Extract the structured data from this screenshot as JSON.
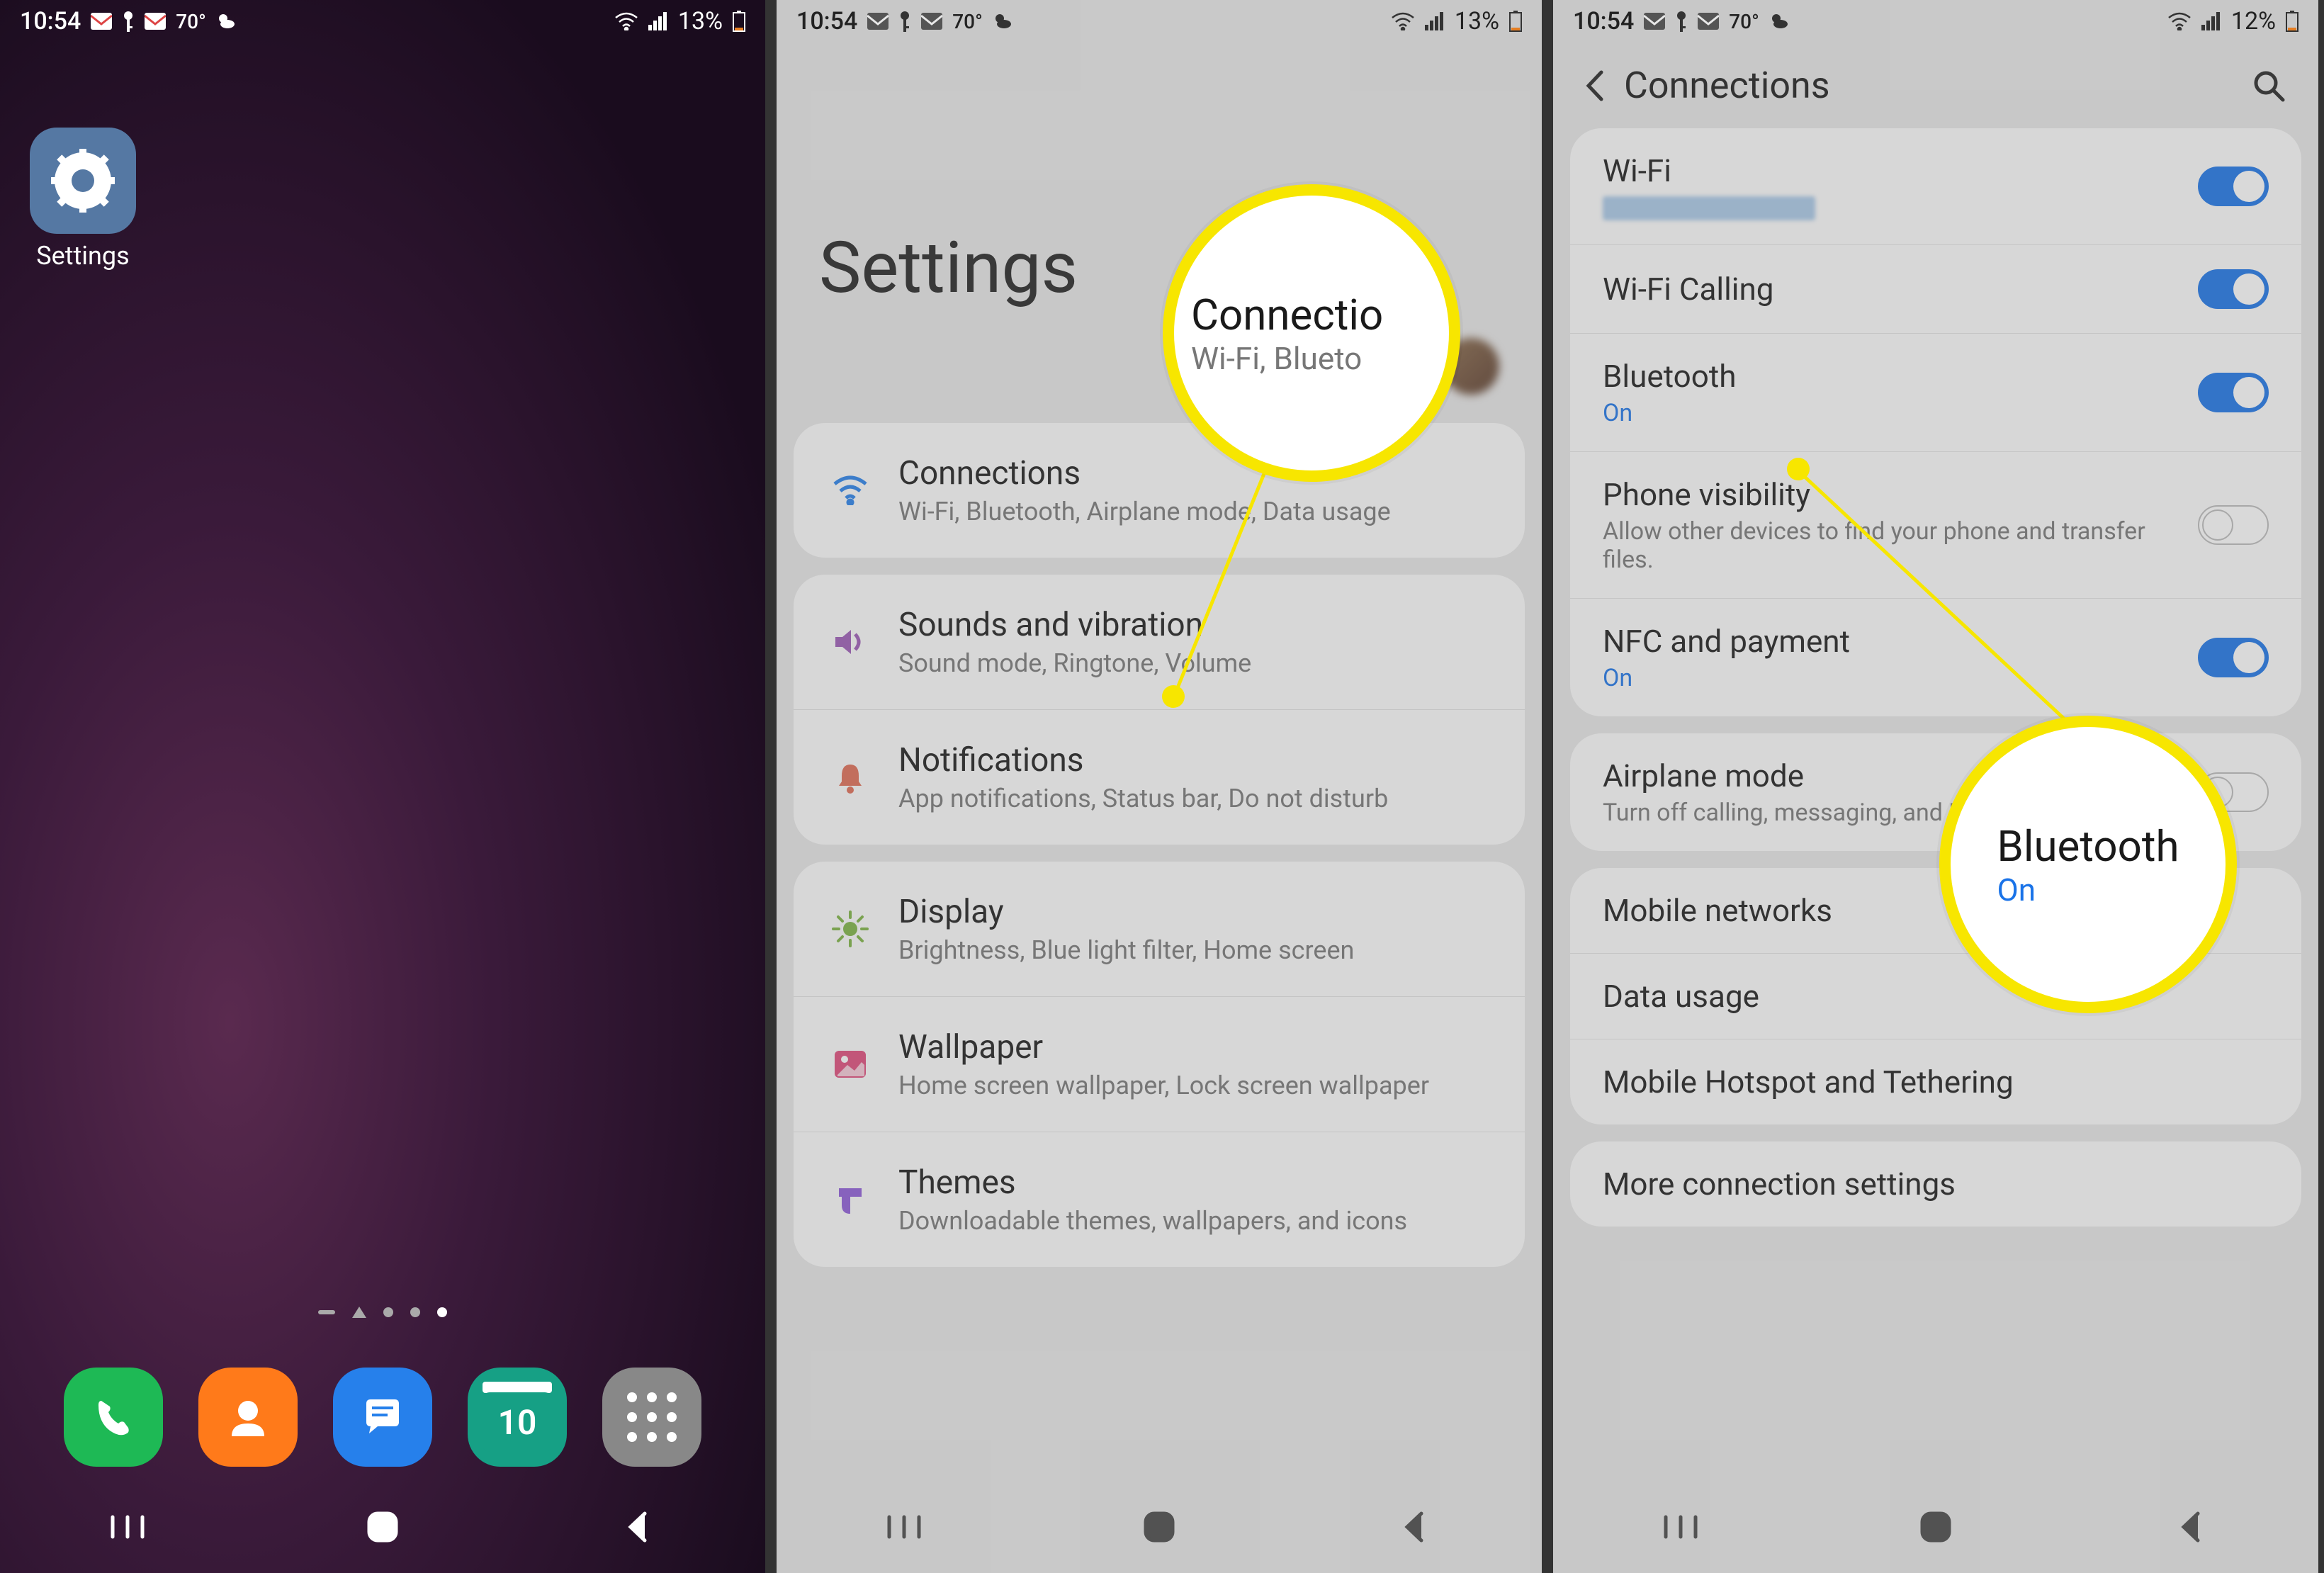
{
  "panel1": {
    "status": {
      "time": "10:54",
      "temp": "70°",
      "battery": "13%"
    },
    "settings_label": "Settings",
    "dock": {
      "calendar_day": "10"
    }
  },
  "panel2": {
    "status": {
      "time": "10:54",
      "temp": "70°",
      "battery": "13%"
    },
    "header": "Settings",
    "callout": {
      "title": "Connectio",
      "sub": "Wi-Fi, Blueto"
    },
    "groups": [
      {
        "rows": [
          {
            "icon": "wifi",
            "color": "#2680eb",
            "title": "Connections",
            "sub": "Wi-Fi, Bluetooth, Airplane mode, Data usage"
          }
        ]
      },
      {
        "rows": [
          {
            "icon": "sound",
            "color": "#9b59b6",
            "title": "Sounds and vibration",
            "sub": "Sound mode, Ringtone, Volume"
          },
          {
            "icon": "bell",
            "color": "#e06b54",
            "title": "Notifications",
            "sub": "App notifications, Status bar, Do not disturb"
          }
        ]
      },
      {
        "rows": [
          {
            "icon": "sun",
            "color": "#7cb342",
            "title": "Display",
            "sub": "Brightness, Blue light filter, Home screen"
          },
          {
            "icon": "image",
            "color": "#e04a7a",
            "title": "Wallpaper",
            "sub": "Home screen wallpaper, Lock screen wallpaper"
          },
          {
            "icon": "brush",
            "color": "#8e5ad8",
            "title": "Themes",
            "sub": "Downloadable themes, wallpapers, and icons"
          }
        ]
      }
    ]
  },
  "panel3": {
    "status": {
      "time": "10:54",
      "temp": "70°",
      "battery": "12%"
    },
    "header": "Connections",
    "callout": {
      "title": "Bluetooth",
      "sub": "On"
    },
    "groups": [
      [
        {
          "title": "Wi-Fi",
          "sub_type": "wifi-blur",
          "toggle": "on"
        },
        {
          "title": "Wi-Fi Calling",
          "toggle": "on"
        },
        {
          "title": "Bluetooth",
          "sub": "On",
          "sub_on": true,
          "toggle": "on"
        },
        {
          "title": "Phone visibility",
          "sub": "Allow other devices to find your phone and transfer files.",
          "toggle": "off"
        },
        {
          "title": "NFC and payment",
          "sub": "On",
          "sub_on": true,
          "toggle": "on"
        }
      ],
      [
        {
          "title": "Airplane mode",
          "sub": "Turn off calling, messaging, and Mobile data.",
          "toggle": "off"
        }
      ],
      [
        {
          "title": "Mobile networks"
        },
        {
          "title": "Data usage"
        },
        {
          "title": "Mobile Hotspot and Tethering"
        }
      ],
      [
        {
          "title": "More connection settings"
        }
      ]
    ]
  }
}
